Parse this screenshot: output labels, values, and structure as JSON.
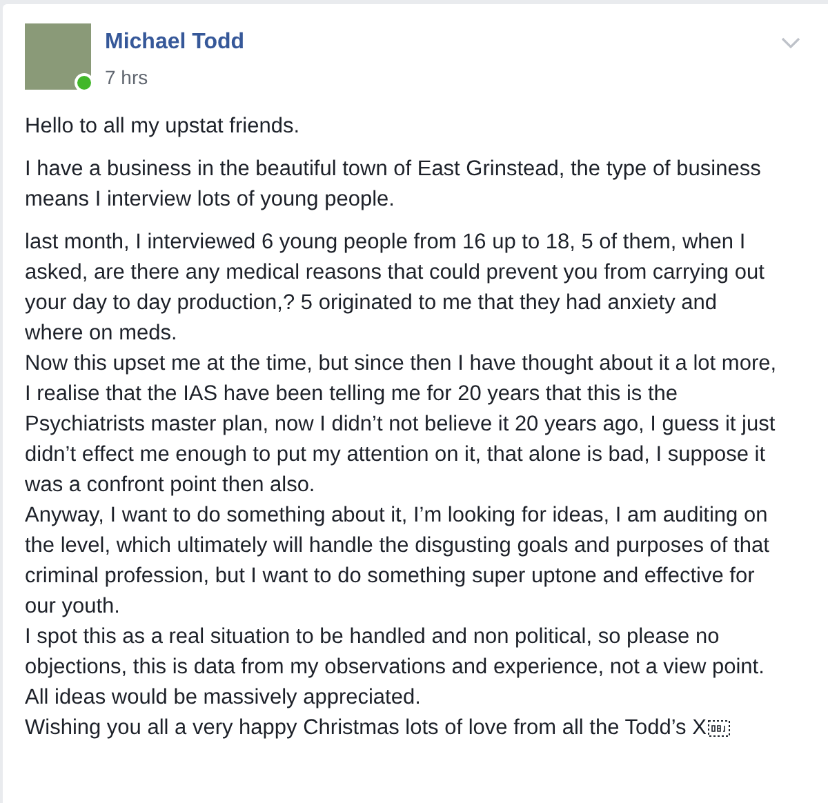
{
  "post": {
    "author": "Michael Todd",
    "time": "7 hrs",
    "online": true,
    "paragraphs": [
      {
        "lines": [
          "Hello to all my upstat friends."
        ]
      },
      {
        "lines": [
          "I have a business in the beautiful town of East Grinstead, the type of business means I interview lots of young people."
        ]
      },
      {
        "lines": [
          "last month, I interviewed 6 young people from 16 up to 18, 5 of them, when I asked, are there any medical reasons that could prevent you from carrying out your day to day production,? 5 originated to me that they had anxiety and where on meds.",
          "Now this upset me at the time, but since then I have thought about it a lot more, I realise that the IAS have been telling me for 20 years that this is the Psychiatrists master plan, now I didn’t not believe it 20 years ago, I guess it just didn’t effect me enough to put my attention on it, that alone is bad, I suppose it was a confront point then also.",
          "Anyway, I want to do something about it, I’m looking for ideas, I am auditing on the level, which ultimately will handle the disgusting goals and purposes of that criminal profession, but I want to do something super uptone and effective for our youth.",
          "I spot this as a real situation to be handled and non political, so please no objections, this is data from my observations and experience, not a view point.",
          "All ideas would be massively appreciated.",
          "Wishing you all a very happy Christmas lots of love from all the Todd’s X"
        ]
      }
    ]
  }
}
